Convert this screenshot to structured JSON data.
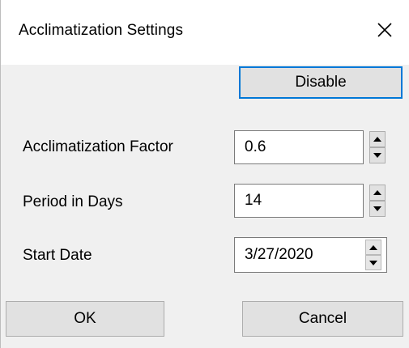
{
  "window": {
    "title": "Acclimatization Settings",
    "close_icon": "close-icon"
  },
  "toolbar": {
    "disable_label": "Disable"
  },
  "fields": {
    "factor": {
      "label": "Acclimatization Factor",
      "value": "0.6"
    },
    "period": {
      "label": "Period in Days",
      "value": "14"
    },
    "start_date": {
      "label": "Start Date",
      "value": "3/27/2020"
    }
  },
  "footer": {
    "ok_label": "OK",
    "cancel_label": "Cancel"
  },
  "colors": {
    "focus_border": "#0078d7",
    "button_face": "#e1e1e1",
    "dialog_bg": "#f0f0f0"
  }
}
